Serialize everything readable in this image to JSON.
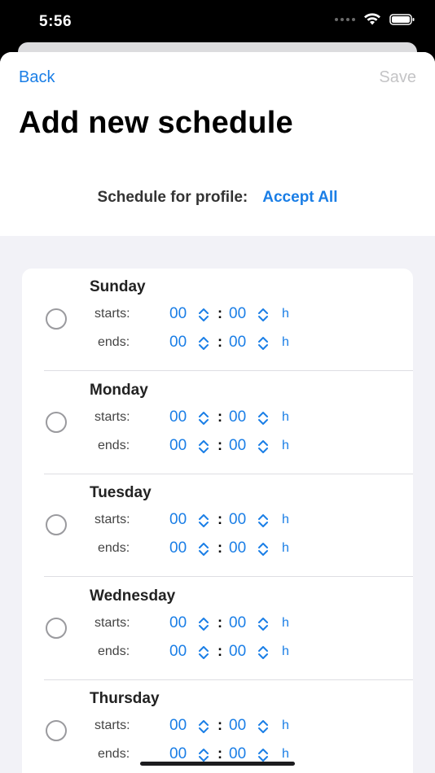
{
  "status": {
    "time": "5:56"
  },
  "nav": {
    "back_label": "Back",
    "save_label": "Save"
  },
  "title": "Add new schedule",
  "profile": {
    "label": "Schedule for profile:",
    "value": "Accept All"
  },
  "labels": {
    "starts": "starts:",
    "ends": "ends:",
    "unit": "h",
    "colon": ":"
  },
  "days": [
    {
      "name": "Sunday",
      "starts": {
        "hour": "00",
        "minute": "00"
      },
      "ends": {
        "hour": "00",
        "minute": "00"
      }
    },
    {
      "name": "Monday",
      "starts": {
        "hour": "00",
        "minute": "00"
      },
      "ends": {
        "hour": "00",
        "minute": "00"
      }
    },
    {
      "name": "Tuesday",
      "starts": {
        "hour": "00",
        "minute": "00"
      },
      "ends": {
        "hour": "00",
        "minute": "00"
      }
    },
    {
      "name": "Wednesday",
      "starts": {
        "hour": "00",
        "minute": "00"
      },
      "ends": {
        "hour": "00",
        "minute": "00"
      }
    },
    {
      "name": "Thursday",
      "starts": {
        "hour": "00",
        "minute": "00"
      },
      "ends": {
        "hour": "00",
        "minute": "00"
      }
    }
  ],
  "colors": {
    "accent": "#1a7ee6",
    "disabled": "#c4c4c6",
    "background": "#f2f2f7"
  },
  "icons": {
    "wifi": "wifi-icon",
    "battery": "battery-icon",
    "signal": "signal-dots-icon",
    "stepper": "chevron-up-down-icon"
  }
}
